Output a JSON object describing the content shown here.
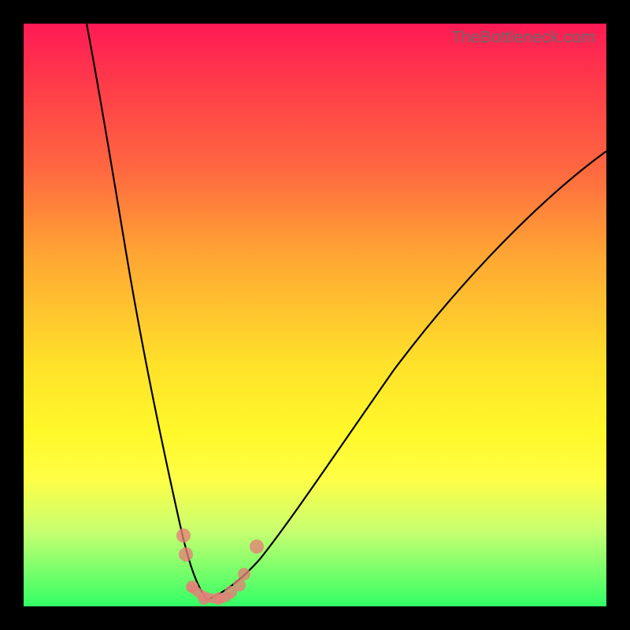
{
  "watermark": "TheBottleneck.com",
  "colors": {
    "frame_bg_top": "#ff1a55",
    "frame_bg_bottom": "#33ff66",
    "curve_stroke": "#000000",
    "marker_fill": "#e47f78"
  },
  "chart_data": {
    "type": "line",
    "title": "",
    "xlabel": "",
    "ylabel": "",
    "xlim": [
      0,
      100
    ],
    "ylim": [
      0,
      100
    ],
    "grid": false,
    "legend": false,
    "series": [
      {
        "name": "left-branch",
        "x": [
          10.8,
          12,
          14,
          16,
          18,
          20,
          22,
          24,
          25.8,
          27.5,
          29,
          30.5,
          31.5
        ],
        "y": [
          100,
          90,
          74,
          59,
          45,
          33,
          23,
          14,
          8,
          4,
          1.5,
          0.5,
          0
        ]
      },
      {
        "name": "right-branch",
        "x": [
          31.5,
          34,
          38,
          44,
          52,
          62,
          74,
          88,
          100
        ],
        "y": [
          0,
          1,
          3,
          8,
          16,
          28,
          44,
          62,
          78
        ]
      }
    ],
    "markers": {
      "name": "highlighted-points",
      "points": [
        {
          "x": 27.5,
          "y": 11
        },
        {
          "x": 27.9,
          "y": 8
        },
        {
          "x": 29.0,
          "y": 2
        },
        {
          "x": 31.0,
          "y": 0.7
        },
        {
          "x": 33.5,
          "y": 0.7
        },
        {
          "x": 35.8,
          "y": 1.8
        },
        {
          "x": 37.0,
          "y": 3.0
        },
        {
          "x": 40.0,
          "y": 9.8
        },
        {
          "x": 37.8,
          "y": 5.2
        }
      ]
    },
    "notes": "Axes and tick labels are not visible in the source image; values are normalized 0-100 estimates. The vertical axis is inverted visually (y increases downward is not implied; y here represents height above the green baseline)."
  }
}
